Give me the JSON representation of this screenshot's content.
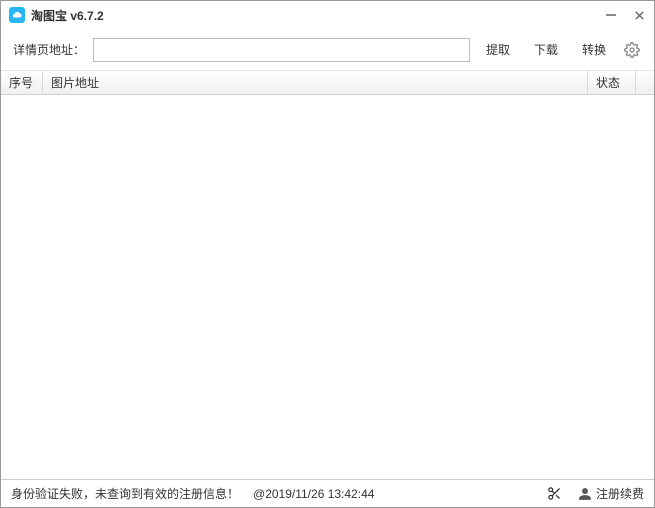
{
  "titlebar": {
    "title": "淘图宝 v6.7.2"
  },
  "toolbar": {
    "label": "详情页地址：",
    "url_value": "",
    "extract_label": "提取",
    "download_label": "下载",
    "convert_label": "转换"
  },
  "table": {
    "columns": {
      "index": "序号",
      "url": "图片地址",
      "status": "状态"
    },
    "rows": []
  },
  "statusbar": {
    "message": "身份验证失败，未查询到有效的注册信息！",
    "timestamp": "@2019/11/26 13:42:44",
    "register_label": "注册续费"
  },
  "icons": {
    "app": "cloud-icon",
    "gear": "gear-icon",
    "minimize": "minimize-icon",
    "close": "close-icon",
    "scissors": "scissors-icon",
    "user": "user-icon"
  }
}
